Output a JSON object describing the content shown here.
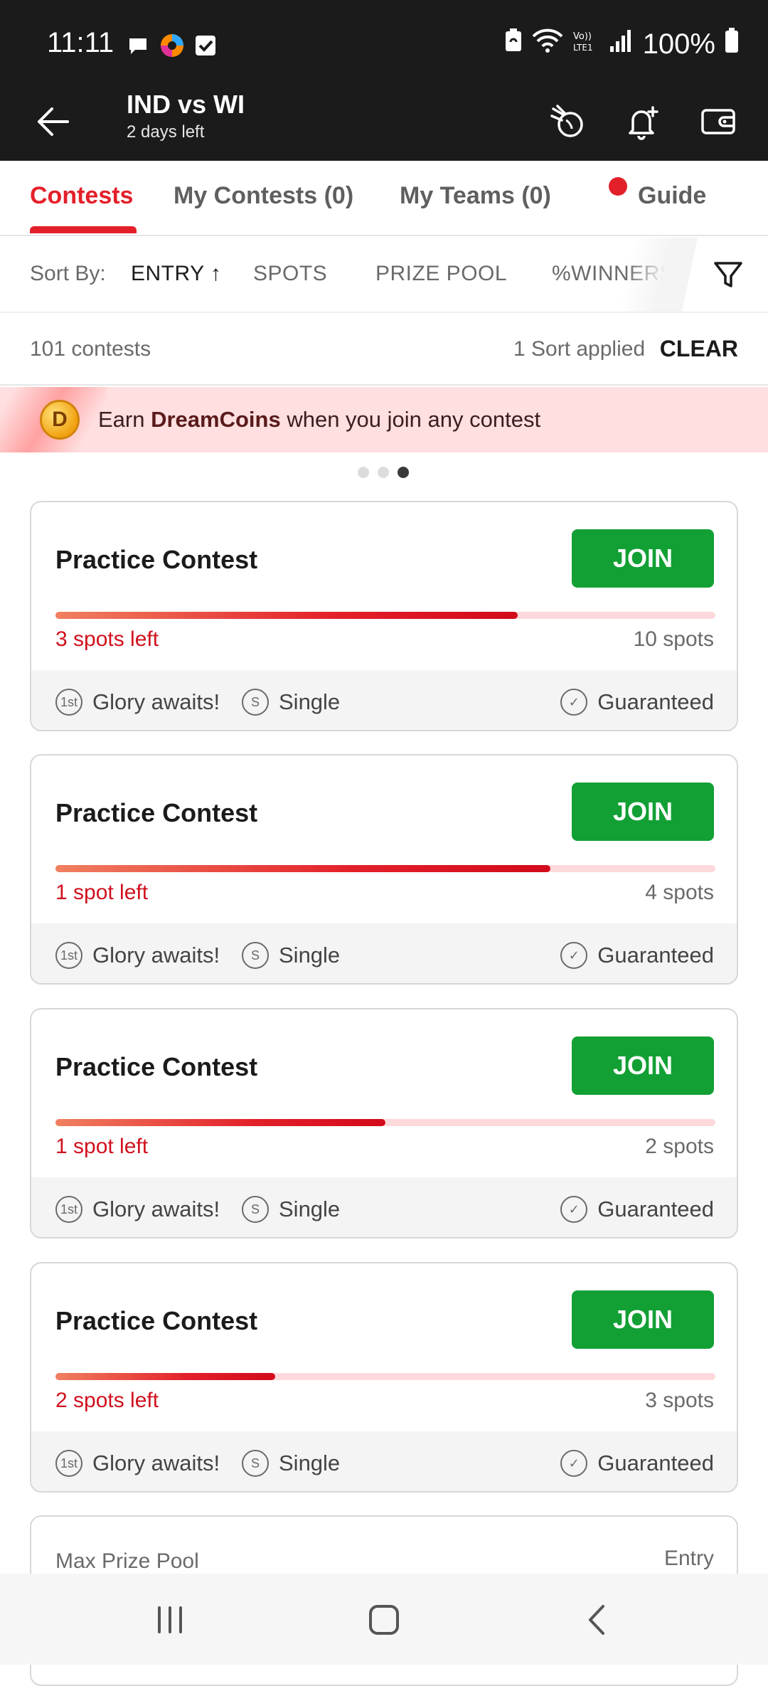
{
  "status_bar": {
    "time": "11:11",
    "battery": "100%",
    "icons_left": [
      "chat-bubble-icon",
      "color-wheel-icon",
      "checkbox-icon"
    ],
    "icons_right": [
      "battery-saver-icon",
      "wifi-icon",
      "volte-lte-icon",
      "signal-icon",
      "battery-icon"
    ]
  },
  "header": {
    "title": "IND vs WI",
    "subtitle": "2 days left",
    "actions": [
      "fantasy-points-icon",
      "bell-add-icon",
      "wallet-icon"
    ]
  },
  "tabs": [
    {
      "label": "Contests",
      "active": true
    },
    {
      "label": "My Contests (0)",
      "active": false
    },
    {
      "label": "My Teams (0)",
      "active": false
    },
    {
      "label": "Guide",
      "active": false,
      "dot": true
    }
  ],
  "sort": {
    "label": "Sort By:",
    "options": [
      {
        "label": "ENTRY ↑",
        "active": true
      },
      {
        "label": "SPOTS",
        "active": false
      },
      {
        "label": "PRIZE POOL",
        "active": false
      },
      {
        "label": "%WINNERS",
        "active": false
      }
    ]
  },
  "meta": {
    "count": "101 contests",
    "sort_applied": "1 Sort applied",
    "clear": "CLEAR"
  },
  "banner": {
    "coin_letter": "D",
    "text_before": "Earn ",
    "text_bold": "DreamCoins",
    "text_after": " when you join any contest",
    "pager_total": 3,
    "pager_active": 3
  },
  "contests": [
    {
      "title": "Practice Contest",
      "join": "JOIN",
      "fill": 0.7,
      "spots_left": "3 spots left",
      "spots_total": "10 spots",
      "badge1": "Glory awaits!",
      "badge2": "Single",
      "badge3": "Guaranteed"
    },
    {
      "title": "Practice Contest",
      "join": "JOIN",
      "fill": 0.75,
      "spots_left": "1 spot left",
      "spots_total": "4 spots",
      "badge1": "Glory awaits!",
      "badge2": "Single",
      "badge3": "Guaranteed"
    },
    {
      "title": "Practice Contest",
      "join": "JOIN",
      "fill": 0.5,
      "spots_left": "1 spot left",
      "spots_total": "2 spots",
      "badge1": "Glory awaits!",
      "badge2": "Single",
      "badge3": "Guaranteed"
    },
    {
      "title": "Practice Contest",
      "join": "JOIN",
      "fill": 0.333,
      "spots_left": "2 spots left",
      "spots_total": "3 spots",
      "badge1": "Glory awaits!",
      "badge2": "Single",
      "badge3": "Guaranteed"
    }
  ],
  "partial_card": {
    "left": "Max Prize Pool",
    "right": "Entry"
  },
  "colors": {
    "brand_red": "#e3202a",
    "join_green": "#12a035",
    "dark_bar": "#1b1b1b"
  }
}
